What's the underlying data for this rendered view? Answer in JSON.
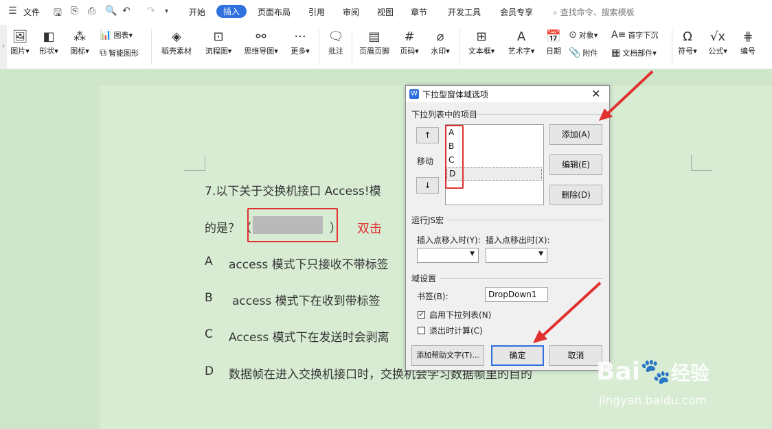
{
  "menubar": {
    "file_label": "文件",
    "tabs": [
      "开始",
      "插入",
      "页面布局",
      "引用",
      "审阅",
      "视图",
      "章节",
      "开发工具",
      "会员专享"
    ],
    "search_placeholder": "查找命令、搜索模板"
  },
  "ribbon": {
    "picture": "图片",
    "shape": "形状",
    "icon": "图标",
    "chart": "图表",
    "smart_shape": "智能图形",
    "material": "稻壳素材",
    "flowchart": "流程图",
    "mindmap": "思维导图",
    "more": "更多",
    "comment": "批注",
    "header_footer": "页眉页脚",
    "page_number": "页码",
    "watermark": "水印",
    "textbox": "文本框",
    "wordart": "艺术字",
    "date": "日期",
    "object": "对象",
    "attachment": "附件",
    "dropcap": "首字下沉",
    "doc_parts": "文档部件",
    "symbol": "符号",
    "formula": "公式",
    "numbering": "编号"
  },
  "document": {
    "question_line1": "7.以下关于交换机接口 Access!模",
    "question_line2_prefix": "的是？（",
    "question_line2_suffix": "）",
    "annotation_doubleclick": "双击",
    "option_a_letter": "A",
    "option_a_text": "access  模式下只接收不带标签",
    "option_b_letter": "B",
    "option_b_text": "access  模式下在收到带标签",
    "option_c_letter": "C",
    "option_c_text": "Access  模式下在发送时会剥离",
    "option_d_letter": "D",
    "option_d_text": "数据帧在进入交换机接口时，交换机会学习数据帧里的目的"
  },
  "dialog": {
    "logo": "W",
    "title": "下拉型窗体域选项",
    "close": "✕",
    "group_items": "下拉列表中的项目",
    "move_up": "↑",
    "move_label": "移动",
    "move_down": "↓",
    "list_items": [
      "A",
      "B",
      "C",
      "D"
    ],
    "add_button": "添加(A)",
    "edit_button": "编辑(E)",
    "delete_button": "删除(D)",
    "group_js": "运行JS宏",
    "on_enter_label": "插入点移入时(Y):",
    "on_exit_label": "插入点移出时(X):",
    "group_field": "域设置",
    "bookmark_label": "书签(B):",
    "bookmark_value": "DropDown1",
    "enable_dropdown_label": "启用下拉列表(N)",
    "enable_dropdown_checked": true,
    "calc_on_exit_label": "退出时计算(C)",
    "calc_on_exit_checked": false,
    "help_text_button": "添加帮助文字(T)...",
    "ok_button": "确定",
    "cancel_button": "取消"
  },
  "watermark": {
    "brand": "Bai",
    "brand_cn": "经验",
    "url": "jingyan.baidu.com"
  },
  "colors": {
    "accent": "#2f6fde",
    "annotation_red": "#e0312f",
    "page_bg": "#d7ecd3"
  }
}
